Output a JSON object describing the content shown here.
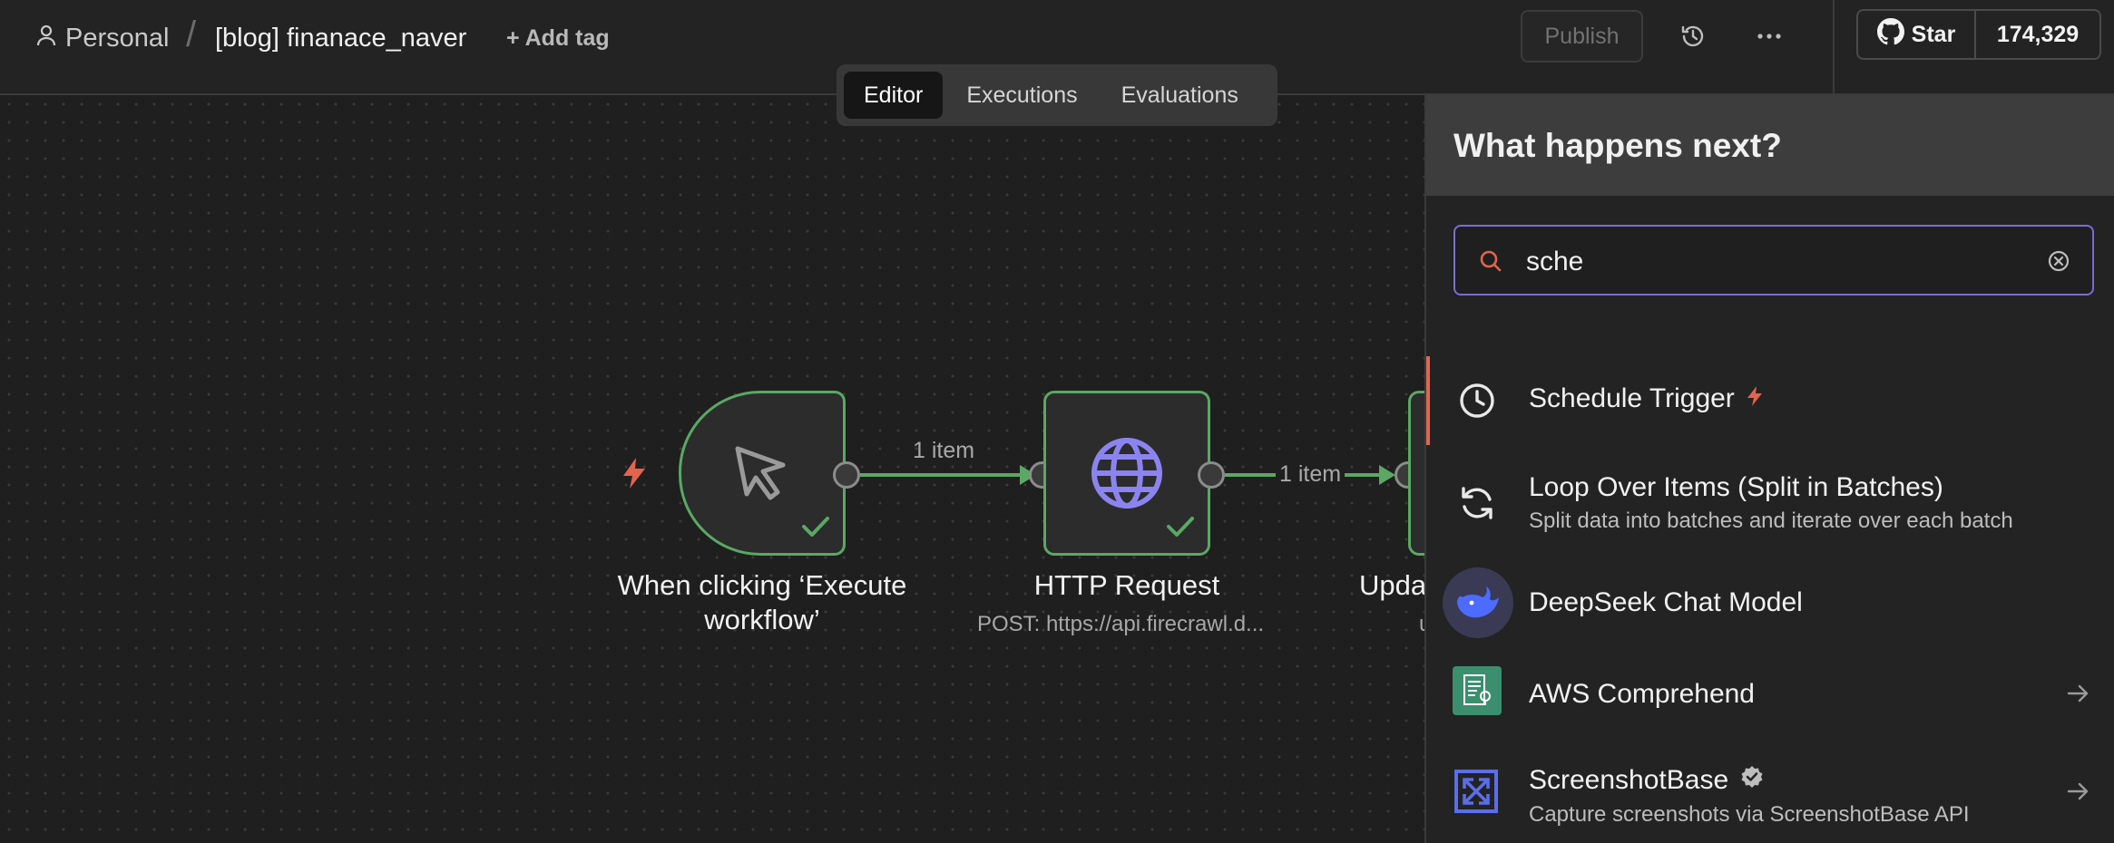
{
  "header": {
    "personal_label": "Personal",
    "separator": "/",
    "workflow_name": "[blog] finanace_naver",
    "add_tag_label": "+ Add tag",
    "publish_label": "Publish",
    "github_star_label": "Star",
    "github_star_count": "174,329"
  },
  "tabs": [
    {
      "label": "Editor",
      "active": true
    },
    {
      "label": "Executions",
      "active": false
    },
    {
      "label": "Evaluations",
      "active": false
    }
  ],
  "canvas": {
    "nodes": [
      {
        "title": "When clicking ‘Execute workflow’",
        "subtitle": "",
        "icon": "cursor-icon",
        "status": "success"
      },
      {
        "title": "HTTP Request",
        "subtitle": "POST: https://api.firecrawl.d...",
        "icon": "globe-icon",
        "status": "success"
      },
      {
        "title": "Upda",
        "subtitle": "u",
        "icon": "",
        "status": "success"
      }
    ],
    "connections": [
      {
        "label": "1 item"
      },
      {
        "label": "1 item"
      }
    ]
  },
  "panel": {
    "title": "What happens next?",
    "search": {
      "value": "sche",
      "placeholder": ""
    },
    "items": [
      {
        "title": "Schedule Trigger",
        "description": "",
        "icon": "clock-icon",
        "badge": "bolt-icon",
        "arrow": false
      },
      {
        "title": "Loop Over Items (Split in Batches)",
        "description": "Split data into batches and iterate over each batch",
        "icon": "refresh-icon",
        "arrow": false
      },
      {
        "title": "DeepSeek Chat Model",
        "description": "",
        "icon": "deepseek-whale-icon",
        "arrow": false
      },
      {
        "title": "AWS Comprehend",
        "description": "",
        "icon": "aws-comprehend-icon",
        "arrow": true
      },
      {
        "title": "ScreenshotBase",
        "description": "Capture screenshots via ScreenshotBase API",
        "icon": "screenshotbase-icon",
        "badge": "verified-icon",
        "arrow": true
      }
    ]
  },
  "colors": {
    "success_green": "#5aa864",
    "accent_purple": "#7b6cd9",
    "trigger_orange": "#e3644e",
    "globe_purple": "#8b84f0"
  }
}
